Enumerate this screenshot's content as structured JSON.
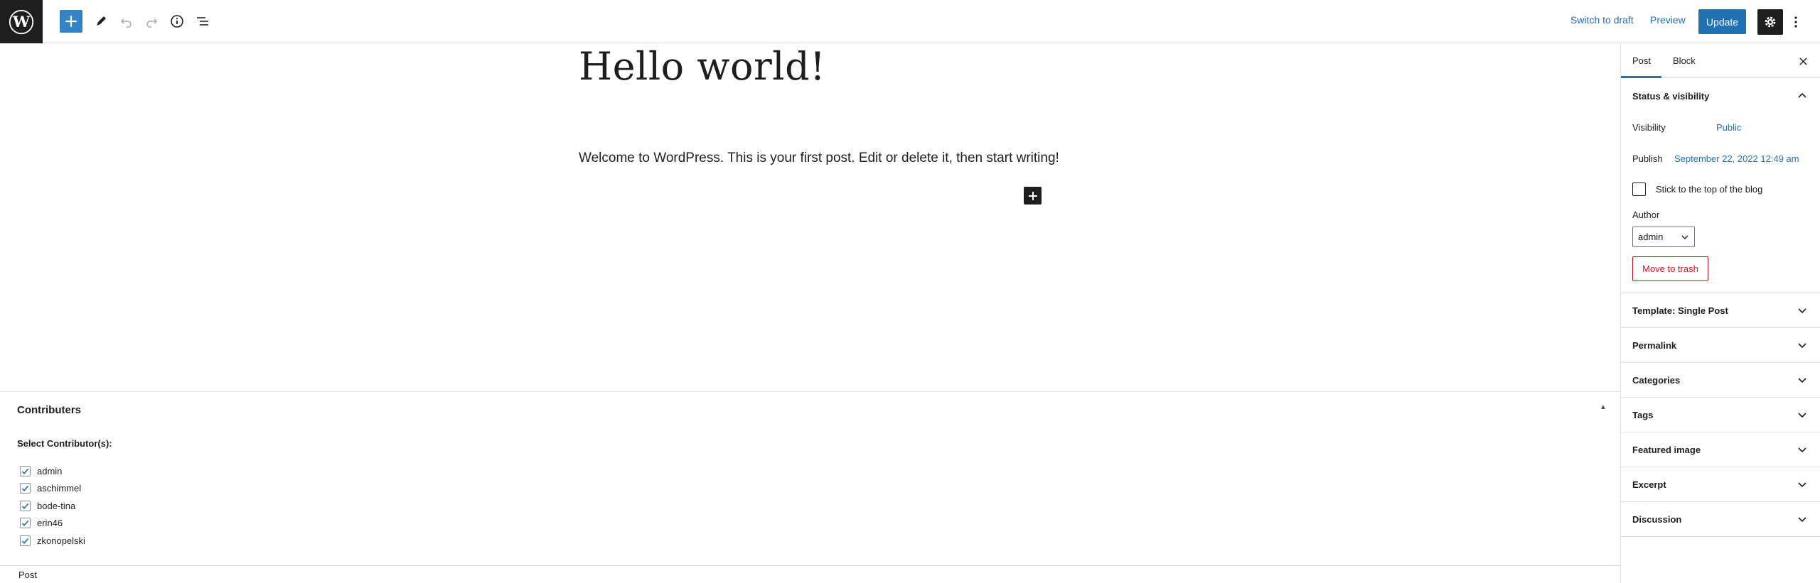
{
  "toolbar": {
    "switch_to_draft": "Switch to draft",
    "preview": "Preview",
    "update": "Update"
  },
  "icons": {
    "logo": "wordpress-logo",
    "add": "plus-icon",
    "tools": "pencil-icon",
    "undo": "undo-icon",
    "redo": "redo-icon",
    "details": "info-icon",
    "outline": "list-view-icon",
    "settings": "gear-icon",
    "options": "more-vertical-icon"
  },
  "editor": {
    "title": "Hello world!",
    "paragraph": "Welcome to WordPress. This is your first post. Edit or delete it, then start writing!"
  },
  "metabox": {
    "title": "Contributers",
    "select_label": "Select Contributor(s):",
    "contributors": [
      {
        "name": "admin",
        "checked": true
      },
      {
        "name": "aschimmel",
        "checked": true
      },
      {
        "name": "bode-tina",
        "checked": true
      },
      {
        "name": "erin46",
        "checked": true
      },
      {
        "name": "zkonopelski",
        "checked": true
      }
    ]
  },
  "footer": {
    "breadcrumb": "Post"
  },
  "sidebar": {
    "tabs": [
      "Post",
      "Block"
    ],
    "status": {
      "heading": "Status & visibility",
      "visibility_label": "Visibility",
      "visibility_value": "Public",
      "publish_label": "Publish",
      "publish_value": "September 22, 2022 12:49 am",
      "stick_label": "Stick to the top of the blog",
      "stick_checked": false,
      "author_label": "Author",
      "author_value": "admin",
      "trash_label": "Move to trash"
    },
    "panels": [
      "Template: Single Post",
      "Permalink",
      "Categories",
      "Tags",
      "Featured image",
      "Excerpt",
      "Discussion"
    ]
  },
  "colors": {
    "accent": "#2271b1",
    "dark": "#1e1e1e",
    "danger": "#cc1818"
  }
}
